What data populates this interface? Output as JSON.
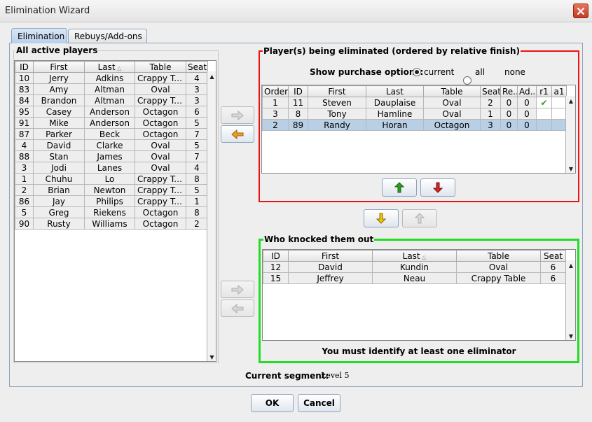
{
  "window": {
    "title": "Elimination Wizard"
  },
  "tabs": [
    {
      "label": "Elimination",
      "active": true
    },
    {
      "label": "Rebuys/Add-ons",
      "active": false
    }
  ],
  "active_players": {
    "title": "All active players",
    "columns": [
      "ID",
      "First",
      "Last",
      "Table",
      "Seat"
    ],
    "sorted_column": "Last",
    "rows": [
      [
        "10",
        "Jerry",
        "Adkins",
        "Crappy Ta...",
        "4"
      ],
      [
        "83",
        "Amy",
        "Altman",
        "Oval",
        "3"
      ],
      [
        "84",
        "Brandon",
        "Altman",
        "Crappy Ta...",
        "3"
      ],
      [
        "95",
        "Casey",
        "Anderson",
        "Octagon",
        "6"
      ],
      [
        "91",
        "Mike",
        "Anderson",
        "Octagon",
        "5"
      ],
      [
        "87",
        "Parker",
        "Beck",
        "Octagon",
        "7"
      ],
      [
        "4",
        "David",
        "Clarke",
        "Oval",
        "5"
      ],
      [
        "88",
        "Stan",
        "James",
        "Oval",
        "7"
      ],
      [
        "3",
        "Jodi",
        "Lanes",
        "Oval",
        "4"
      ],
      [
        "1",
        "Chuhu",
        "Lo",
        "Crappy Ta...",
        "8"
      ],
      [
        "2",
        "Brian",
        "Newton",
        "Crappy Ta...",
        "5"
      ],
      [
        "86",
        "Jay",
        "Philips",
        "Crappy Ta...",
        "1"
      ],
      [
        "5",
        "Greg",
        "Riekens",
        "Octagon",
        "8"
      ],
      [
        "90",
        "Rusty",
        "Williams",
        "Octagon",
        "2"
      ]
    ]
  },
  "eliminated": {
    "title": "Player(s) being eliminated (ordered by relative finish)",
    "purchase_label": "Show purchase options:",
    "purchase_options": [
      "current",
      "all",
      "none"
    ],
    "purchase_selected": "current",
    "columns": [
      "Order",
      "ID",
      "First",
      "Last",
      "Table",
      "Seat",
      "Re...",
      "Ad...",
      "r1",
      "a1"
    ],
    "rows": [
      [
        "1",
        "11",
        "Steven",
        "Dauplaise",
        "Oval",
        "2",
        "0",
        "0",
        "✔",
        ""
      ],
      [
        "3",
        "8",
        "Tony",
        "Hamline",
        "Oval",
        "1",
        "0",
        "0",
        "",
        ""
      ],
      [
        "2",
        "89",
        "Randy",
        "Horan",
        "Octagon",
        "3",
        "0",
        "0",
        "",
        ""
      ]
    ],
    "selected_row": 2
  },
  "eliminators": {
    "title": "Who knocked them out",
    "columns": [
      "ID",
      "First",
      "Last",
      "Table",
      "Seat"
    ],
    "sorted_column": "Last",
    "rows": [
      [
        "12",
        "David",
        "Kundin",
        "Oval",
        "6"
      ],
      [
        "15",
        "Jeffrey",
        "Neau",
        "Crappy Table",
        "6"
      ]
    ],
    "message": "You must identify at least one eliminator"
  },
  "segment": {
    "label": "Current segment:",
    "value": "Level 5"
  },
  "footer": {
    "ok_label": "OK",
    "cancel_label": "Cancel"
  },
  "colors": {
    "eliminated_border": "#ee1111",
    "eliminators_border": "#22dd22",
    "arrow_green": "#2e9e1e",
    "arrow_red": "#d42424",
    "arrow_yellow": "#e8b400",
    "arrow_orange": "#f0a020"
  }
}
